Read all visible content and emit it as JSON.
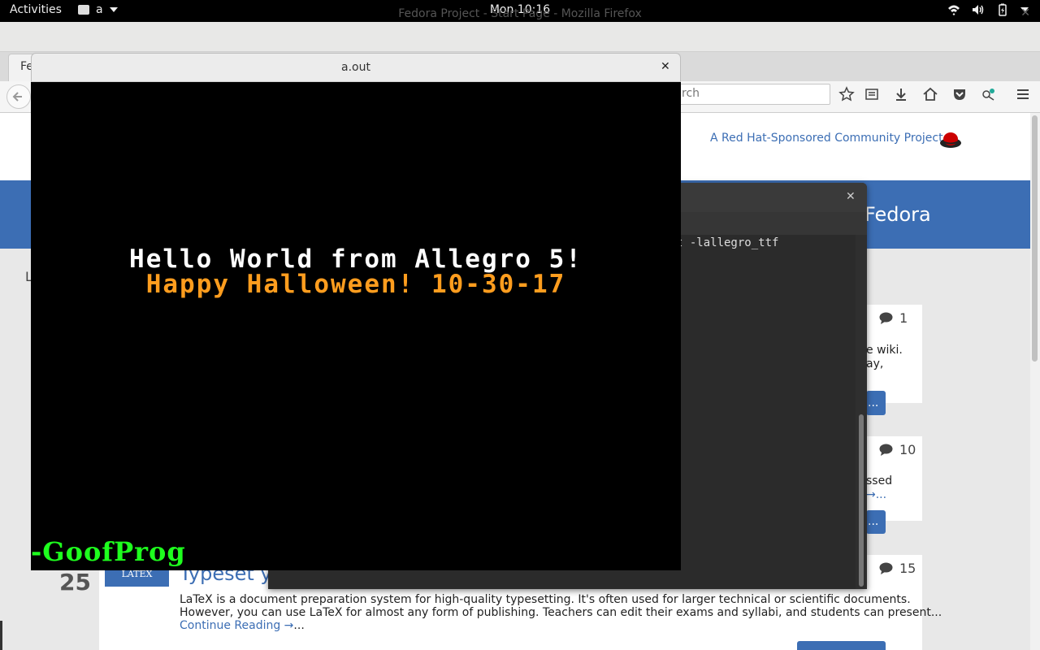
{
  "topbar": {
    "activities": "Activities",
    "app_name": "a",
    "clock": "Mon 10:16",
    "icons": [
      "wifi-icon",
      "volume-icon",
      "battery-icon",
      "power-menu-icon"
    ]
  },
  "firefox": {
    "title": "Fedora Project - Start Page - Mozilla Firefox",
    "tab_label": "Fe",
    "search_placeholder": "rch",
    "nav_icons": [
      "star-icon",
      "reading-list-icon",
      "download-icon",
      "home-icon",
      "pocket-icon",
      "addon-icon",
      "menu-icon"
    ]
  },
  "page": {
    "sponsor": "A Red Hat-Sponsored Community Project",
    "banner_text": "Fedora",
    "left_label": "L",
    "cards": [
      {
        "comments": "1",
        "snippet1": "e wiki.",
        "snippet2": "ay,",
        "readmore": "..."
      },
      {
        "comments": "10",
        "snippet1": "ssed",
        "snippet2": "→...",
        "readmore": "..."
      },
      {
        "comments": "15",
        "day": "25",
        "badge": "LATEX",
        "title": "Typeset yo",
        "body1": "LaTeX is a document preparation system for high-quality typesetting. It's often used for larger technical or scientific documents.",
        "body2": "However, you can use LaTeX for almost any form of publishing. Teachers can edit their exams and syllabi, and students can present...",
        "continue": "Continue Reading →",
        "ellipsis": "..."
      }
    ]
  },
  "terminal": {
    "line": "t -lallegro_ttf"
  },
  "aout": {
    "title": "a.out",
    "hello": "Hello World from Allegro 5!",
    "halloween": "Happy Halloween! 10-30-17",
    "signature": "-GoofProg",
    "colors": {
      "hello": "#ffffff",
      "halloween": "#ff9d1e",
      "signature": "#1eff1e"
    }
  }
}
